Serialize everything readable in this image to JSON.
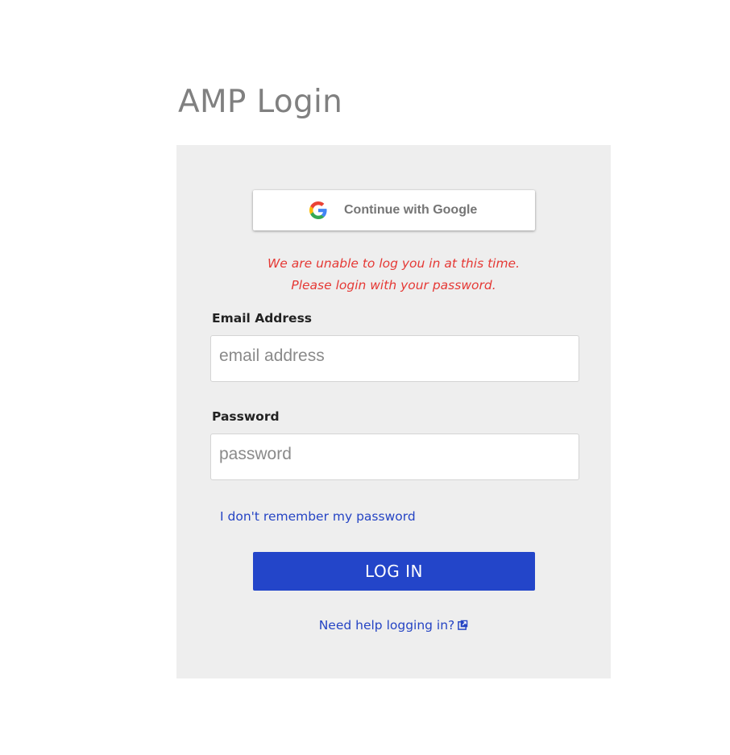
{
  "page": {
    "title": "AMP Login"
  },
  "google_button": {
    "label": "Continue with Google",
    "icon": "google-g-icon"
  },
  "error": {
    "line1": "We are unable to log you in at this time.",
    "line2": "Please login with your password.",
    "color": "#e53935"
  },
  "form": {
    "email": {
      "label": "Email Address",
      "placeholder": "email address",
      "value": ""
    },
    "password": {
      "label": "Password",
      "placeholder": "password",
      "value": ""
    },
    "forgot_link": "I don't remember my password",
    "login_button": "LOG IN",
    "help_link": "Need help logging in?",
    "help_icon": "external-link-icon"
  },
  "colors": {
    "accent": "#2345c9",
    "link": "#2544c4",
    "panel_bg": "#eeeeee",
    "title": "#808080"
  }
}
